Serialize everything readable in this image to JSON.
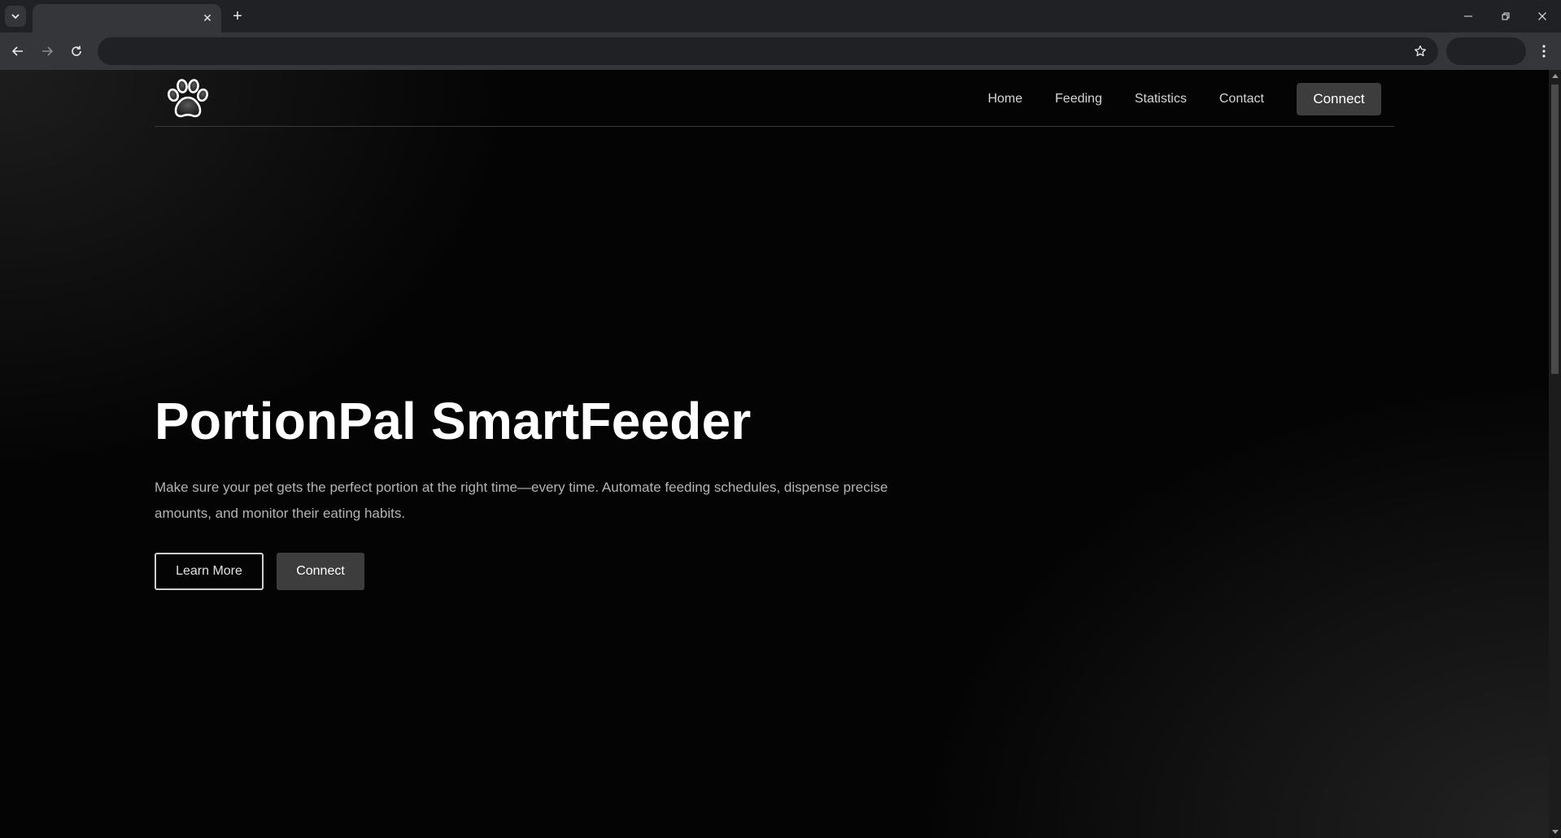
{
  "browser": {
    "tab_title": "",
    "address": "",
    "icons": {
      "tab_search": "chevron-down-icon",
      "tab_close": "close-icon",
      "new_tab": "plus-icon",
      "minimize": "minimize-icon",
      "restore": "restore-icon",
      "close": "close-icon",
      "back": "arrow-left-icon",
      "forward": "arrow-right-icon",
      "reload": "reload-icon",
      "bookmark": "star-icon",
      "menu": "kebab-menu-icon"
    },
    "tab_close_glyph": "✕",
    "new_tab_glyph": "+"
  },
  "site": {
    "logo": "paw-print-icon",
    "nav": {
      "links": [
        "Home",
        "Feeding",
        "Statistics",
        "Contact"
      ],
      "cta": "Connect"
    },
    "hero": {
      "title": "PortionPal SmartFeeder",
      "description": "Make sure your pet gets the perfect portion at the right time—every time. Automate feeding schedules, dispense precise amounts, and monitor their eating habits.",
      "primary_button": "Learn More",
      "secondary_button": "Connect"
    }
  },
  "colors": {
    "chrome_dark": "#202124",
    "chrome_mid": "#35363a",
    "page_bg": "#040404",
    "button_bg": "#3d3d3d",
    "text_primary": "#ffffff",
    "text_muted": "#b4b4b4"
  }
}
